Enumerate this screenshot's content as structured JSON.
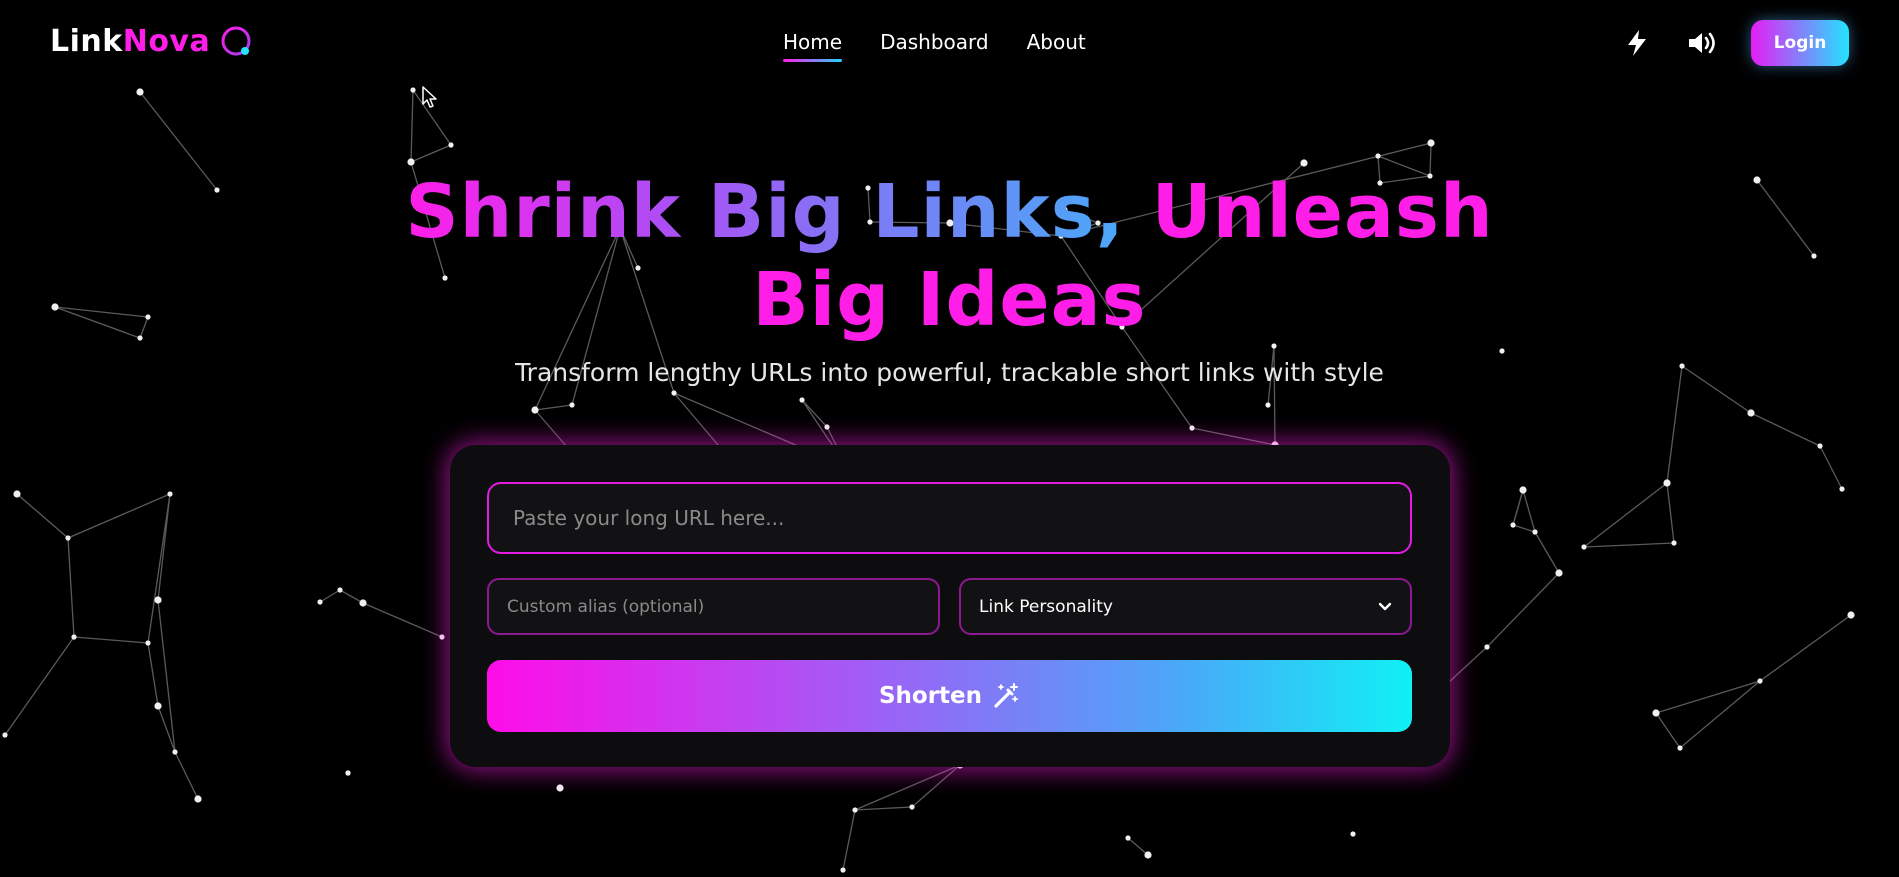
{
  "brand": {
    "name_part1": "Link",
    "name_part2": "Nova"
  },
  "nav": {
    "items": [
      {
        "label": "Home",
        "active": true
      },
      {
        "label": "Dashboard",
        "active": false
      },
      {
        "label": "About",
        "active": false
      }
    ],
    "login_label": "Login",
    "icons": [
      "lightning-icon",
      "volume-icon"
    ]
  },
  "hero": {
    "title_line1_grad": "Shrink Big Links,",
    "title_line1_pink": "Unleash",
    "title_line2": "Big Ideas",
    "subtitle": "Transform lengthy URLs into powerful, trackable short links with style"
  },
  "form": {
    "url_placeholder": "Paste your long URL here...",
    "url_value": "",
    "alias_placeholder": "Custom alias (optional)",
    "alias_value": "",
    "personality_selected": "Link Personality",
    "shorten_label": "Shorten"
  },
  "colors": {
    "accent_pink": "#ff1de8",
    "accent_cyan": "#22d3ff",
    "background": "#000000",
    "card": "#0d0d10"
  }
}
